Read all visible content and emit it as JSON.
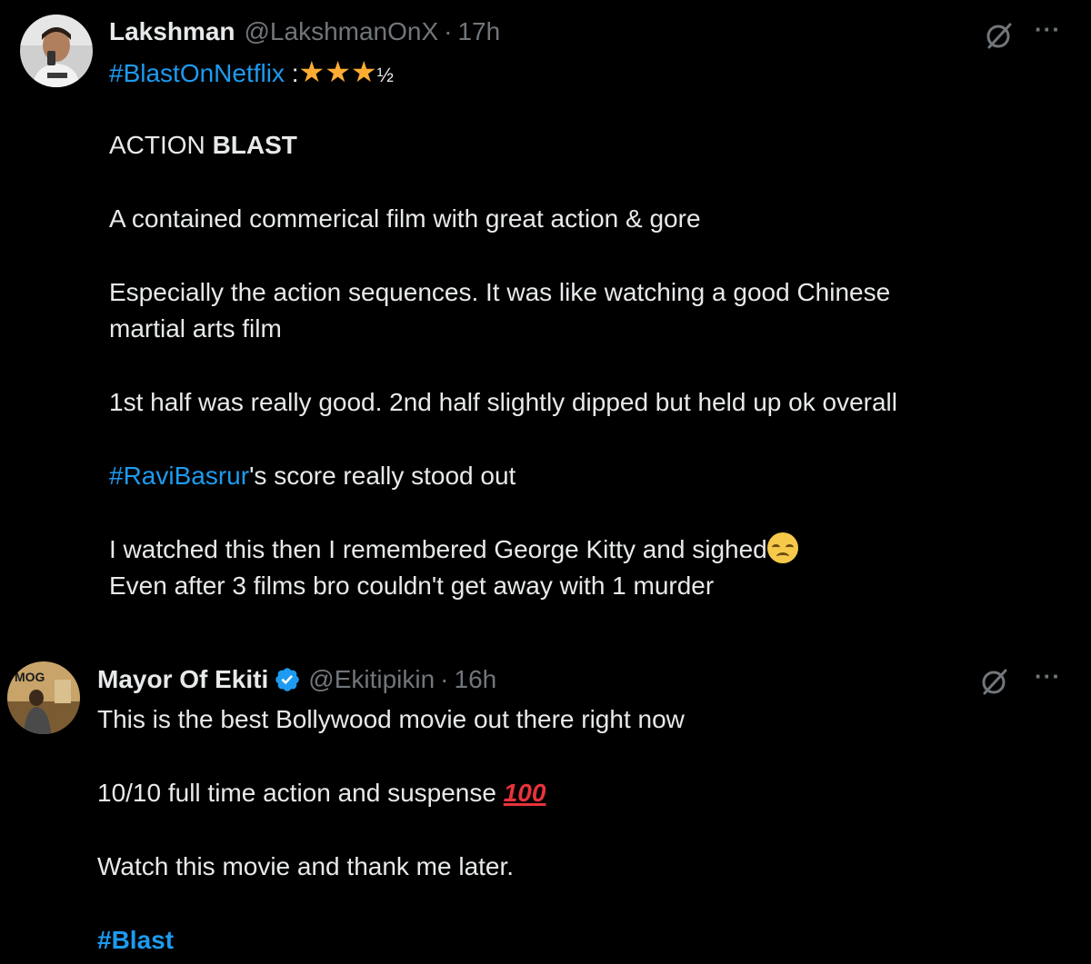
{
  "tweets": [
    {
      "name": "Lakshman",
      "handle": "@LakshmanOnX",
      "separator": "·",
      "time": "17h",
      "verified": false,
      "rating_hashtag": "#BlastOnNetflix",
      "rating_colon": ":",
      "rating_stars": "★★★",
      "rating_half": "½",
      "line_action_prefix": "ACTION ",
      "line_action_bold": "BLAST",
      "line_contained": "A contained commerical film with great action & gore",
      "line_especially_1": "Especially the action sequences. It was like watching a good Chinese",
      "line_especially_2": "martial arts film",
      "line_halves": "1st half was really good. 2nd half slightly dipped but held up ok overall",
      "score_hashtag": "#RaviBasrur",
      "score_rest": "'s score really stood out",
      "line_watched": "I watched this then I remembered George Kitty and sighed",
      "line_even": "Even after 3 films bro couldn't get away with 1 murder",
      "emoji": "disappointed-face"
    },
    {
      "name": "Mayor Of Ekiti",
      "handle": "@Ekitipikin",
      "separator": "·",
      "time": "16h",
      "verified": true,
      "line_best": "This is the best Bollywood movie out there right now",
      "line_score": "10/10 full time action and suspense ",
      "score_emoji_text": "100",
      "line_watch": "Watch this movie and thank me later.",
      "hashtag": "#Blast",
      "avatar_text": "MOG"
    }
  ],
  "colors": {
    "background": "#000000",
    "text": "#e7e9ea",
    "muted": "#71767b",
    "link": "#1d9bf0",
    "star": "#ffac33",
    "verified": "#1d9bf0"
  },
  "icons": [
    "grok-icon",
    "more-options-icon",
    "verified-badge-icon",
    "star-icon",
    "disappointed-face-emoji",
    "hundred-points-emoji"
  ]
}
